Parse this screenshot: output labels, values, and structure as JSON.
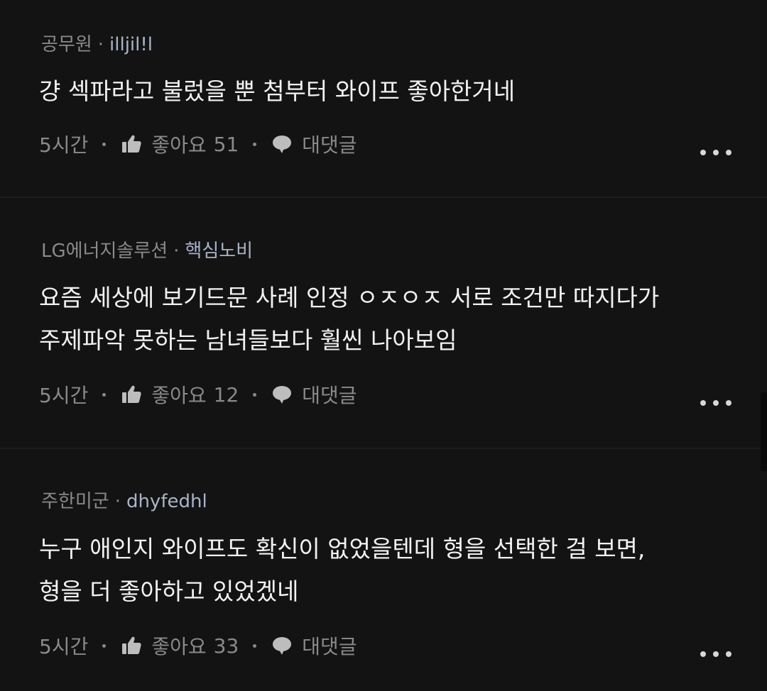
{
  "comments": [
    {
      "company": "공무원",
      "nickname": "illjil!l",
      "text": "걍 섹파라고 불렀을 뿐 첨부터 와이프 좋아한거네",
      "time": "5시간",
      "like_label": "좋아요",
      "like_count": "51",
      "reply_label": "대댓글"
    },
    {
      "company": "LG에너지솔루션",
      "nickname": "핵심노비",
      "text": "요즘 세상에 보기드문 사례 인정 ㅇㅈㅇㅈ 서로 조건만 따지다가\n주제파악 못하는 남녀들보다 훨씬 나아보임",
      "time": "5시간",
      "like_label": "좋아요",
      "like_count": "12",
      "reply_label": "대댓글"
    },
    {
      "company": "주한미군",
      "nickname": "dhyfedhl",
      "text": "누구 애인지 와이프도 확신이 없었을텐데 형을 선택한 걸 보면,\n형을 더 좋아하고 있었겠네",
      "time": "5시간",
      "like_label": "좋아요",
      "like_count": "33",
      "reply_label": "대댓글"
    }
  ],
  "separator_dot": "·",
  "icons": {
    "like": "thumbs-up-icon",
    "reply": "speech-bubble-icon",
    "more": "more-horizontal-icon"
  },
  "colors": {
    "background": "#131313",
    "text": "#f2f2f2",
    "muted": "#8a8a8a",
    "nickname": "#a9b3c8"
  }
}
